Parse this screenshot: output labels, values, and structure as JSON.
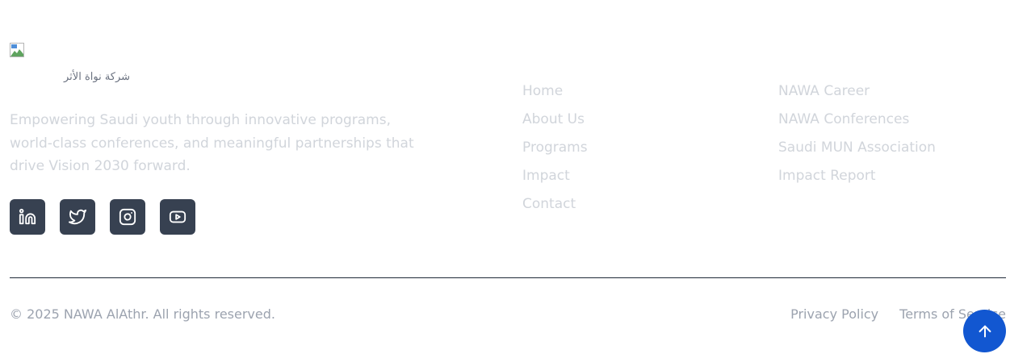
{
  "brand": {
    "logo_alt": "شركة نواة الأثر",
    "tagline": "Empowering Saudi youth through innovative programs, world-class conferences, and meaningful partnerships that drive Vision 2030 forward."
  },
  "socials": [
    {
      "icon": "linkedin-icon"
    },
    {
      "icon": "twitter-icon"
    },
    {
      "icon": "instagram-icon"
    },
    {
      "icon": "youtube-icon"
    }
  ],
  "nav": {
    "quick_links": [
      "Home",
      "About Us",
      "Programs",
      "Impact",
      "Contact"
    ],
    "other_links": [
      "NAWA Career",
      "NAWA Conferences",
      "Saudi MUN Association",
      "Impact Report"
    ]
  },
  "bottom": {
    "copyright": "© 2025 NAWA AlAthr. All rights reserved.",
    "privacy": "Privacy Policy",
    "terms": "Terms of Service"
  },
  "colors": {
    "social_bg": "#374151",
    "link_text": "#d1d5db",
    "muted_text": "#9ca3af",
    "scroll_button": "#1257d1"
  },
  "scroll_top": {
    "icon": "arrow-up-icon"
  }
}
